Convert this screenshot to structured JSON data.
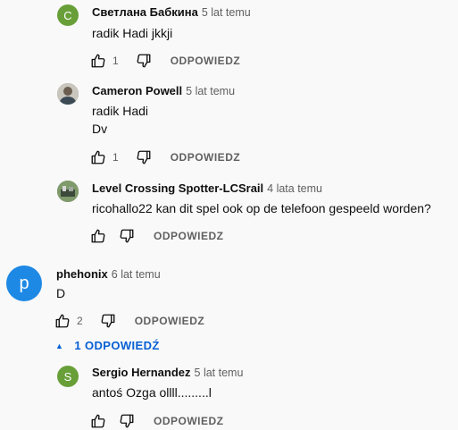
{
  "comments": [
    {
      "avatar_letter": "С",
      "avatar_color": "#689f38",
      "author": "Светлана Бабкина",
      "time": "5 lat temu",
      "text": "radik Hadi jkkji",
      "likes": "1",
      "reply": "ODPOWIEDZ"
    },
    {
      "avatar_letter": "",
      "avatar_color": "#8a8f86",
      "author": "Cameron Powell",
      "time": "5 lat temu",
      "text": "radik Hadi\nDv",
      "likes": "1",
      "reply": "ODPOWIEDZ"
    },
    {
      "avatar_letter": "",
      "avatar_color": "#5a6b54",
      "author": "Level Crossing Spotter-LCSrail",
      "time": "4 lata temu",
      "text": "ricohallo22 kan dit spel ook op de telefoon gespeeld worden?",
      "likes": "",
      "reply": "ODPOWIEDZ"
    },
    {
      "avatar_letter": "p",
      "avatar_color": "#1e88e5",
      "author": "phehonix",
      "time": "6 lat temu",
      "text": "D",
      "likes": "2",
      "reply": "ODPOWIEDZ"
    },
    {
      "avatar_letter": "S",
      "avatar_color": "#689f38",
      "author": "Sergio Hernandez",
      "time": "5 lat temu",
      "text": "antoś Ozga ollll.........l",
      "likes": "",
      "reply": "ODPOWIEDZ"
    }
  ],
  "replies_toggle": {
    "label": "1 ODPOWIEDŹ",
    "color": "#065fd4"
  },
  "icons": {
    "like": "thumb-up-icon",
    "dislike": "thumb-down-icon",
    "toggle": "triangle-up-icon"
  }
}
